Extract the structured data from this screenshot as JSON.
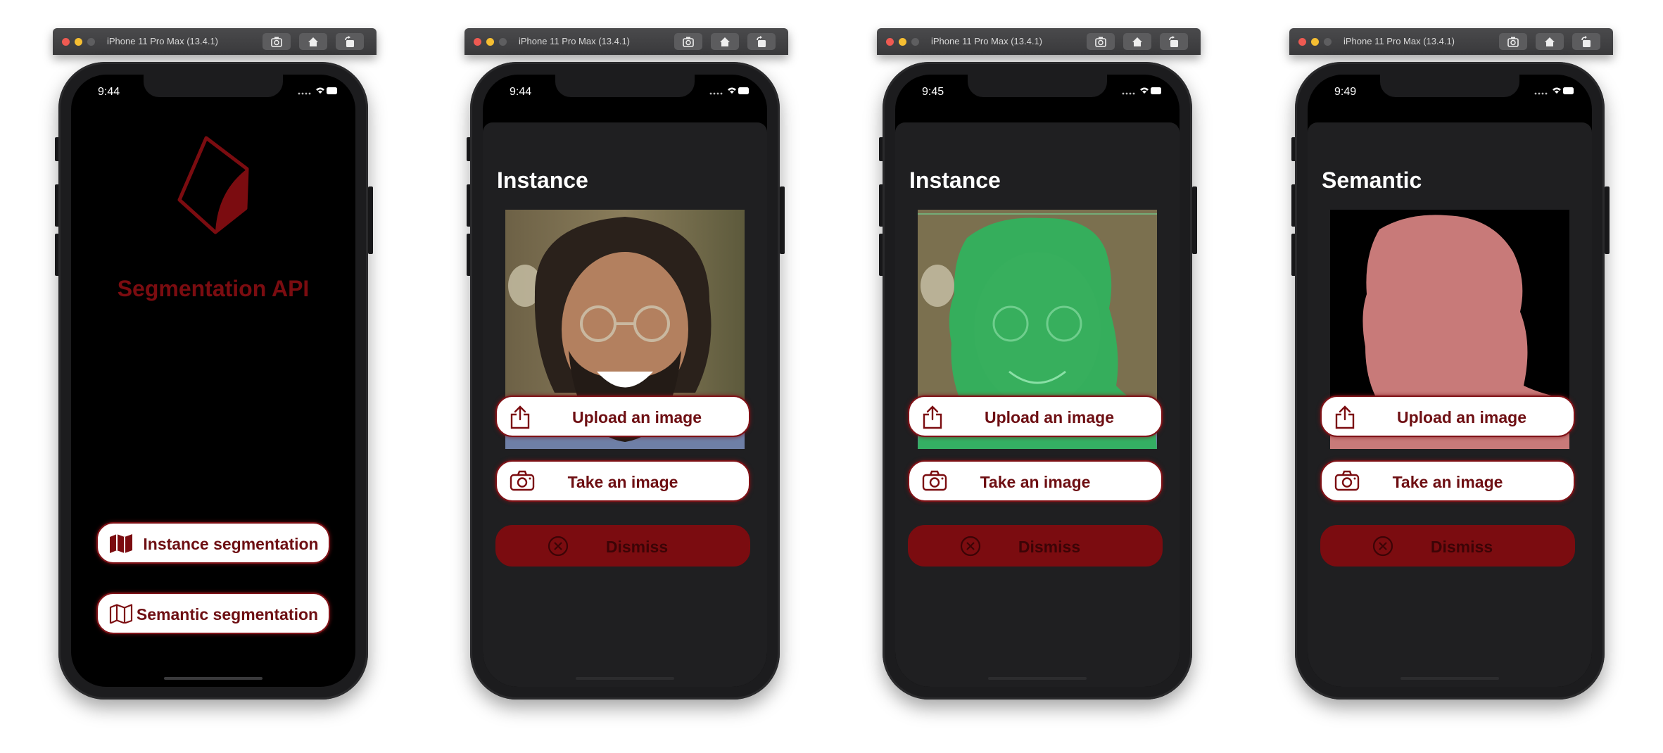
{
  "simulator": {
    "title": "iPhone 11 Pro Max (13.4.1)"
  },
  "screens": [
    {
      "time": "9:44",
      "app_name": "Segmentation API",
      "buttons": {
        "instance": "Instance segmentation",
        "semantic": "Semantic segmentation"
      }
    },
    {
      "time": "9:44",
      "title": "Instance",
      "image": "original-photo",
      "buttons": {
        "upload": "Upload an image",
        "take": "Take an image",
        "dismiss": "Dismiss"
      }
    },
    {
      "time": "9:45",
      "title": "Instance",
      "image": "instance-mask-overlay",
      "buttons": {
        "upload": "Upload an image",
        "take": "Take an image",
        "dismiss": "Dismiss"
      }
    },
    {
      "time": "9:49",
      "title": "Semantic",
      "image": "semantic-mask",
      "buttons": {
        "upload": "Upload an image",
        "take": "Take an image",
        "dismiss": "Dismiss"
      }
    }
  ],
  "colors": {
    "accent": "#7b0c10",
    "instance_mask": "#2fb35e",
    "semantic_mask": "#c87a79",
    "sheet_bg": "#1f1f21"
  }
}
